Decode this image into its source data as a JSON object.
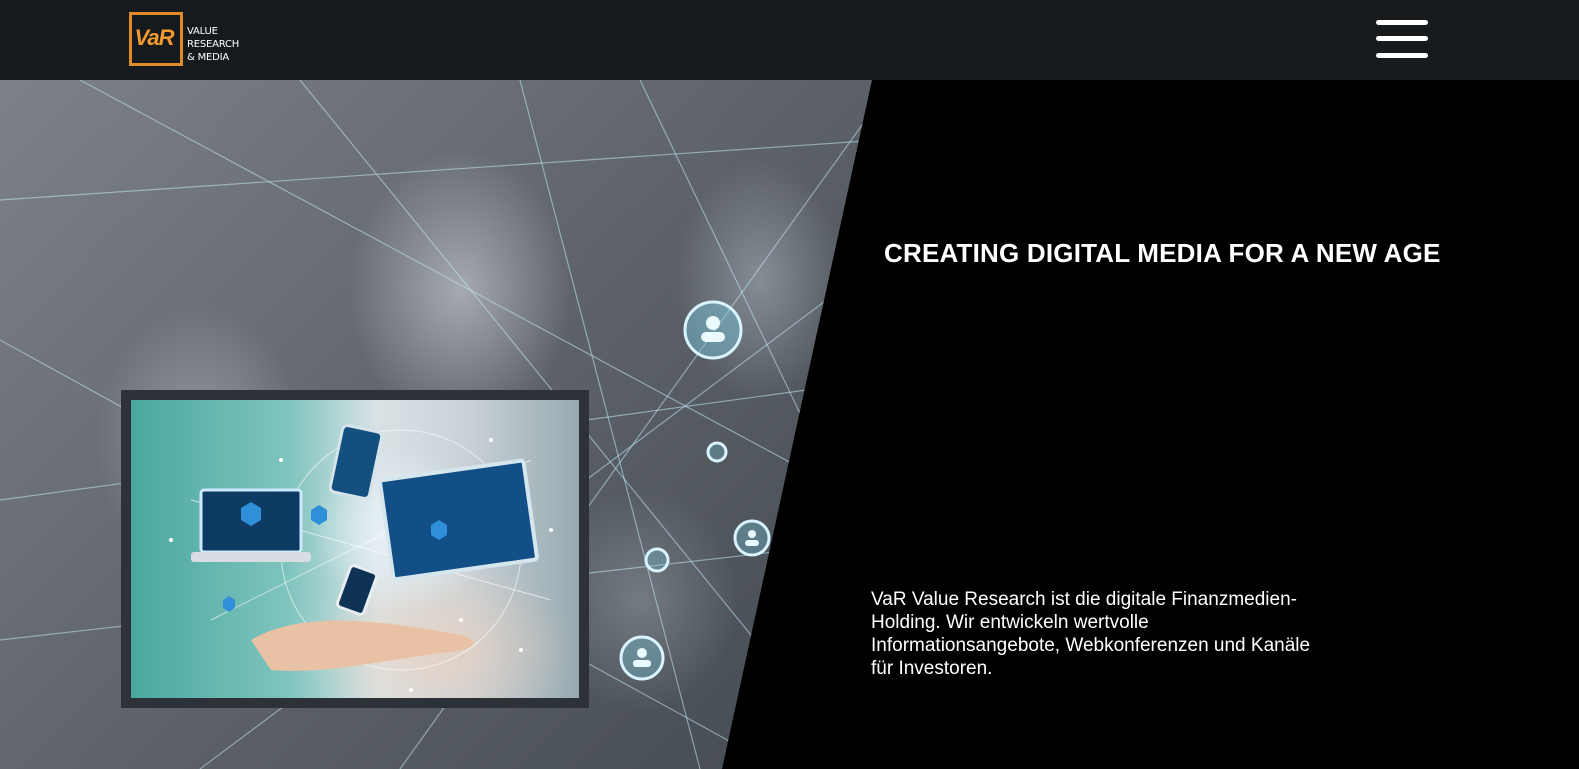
{
  "header": {
    "logo": {
      "monogram": "VaR",
      "lines": [
        "VALUE",
        "RESEARCH",
        "& MEDIA"
      ],
      "accent_color": "#e08a2a"
    },
    "menu_icon": "hamburger-menu-icon"
  },
  "hero": {
    "title": "CREATING DIGITAL MEDIA FOR A NEW AGE",
    "description": "VaR Value Research ist die digitale Finanzmedien-Holding. Wir entwickeln wertvolle Informationsangebote, Webkonferenzen und Kanäle für Investoren."
  },
  "colors": {
    "header_bg": "#171a1d",
    "hero_bg": "#000000",
    "text": "#ffffff",
    "frame": "#2c3238"
  }
}
